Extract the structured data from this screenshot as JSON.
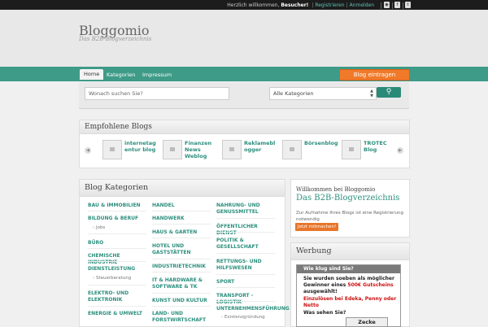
{
  "topbar": {
    "greeting_prefix": "Herzlich willkommen,",
    "greeting_user": "Besucher!",
    "register": "Registrieren",
    "login": "Anmelden",
    "separator": "|",
    "icons": [
      "rss-icon",
      "facebook-icon",
      "twitter-icon"
    ]
  },
  "site": {
    "title": "Bloggomio",
    "subtitle": "Das B2B-Blogverzeichnis"
  },
  "nav": {
    "items": [
      "Home",
      "Kategorien",
      "Impressum"
    ],
    "cta": "Blog eintragen"
  },
  "search": {
    "placeholder": "Wonach suchen Sie?",
    "category_selected": "Alle Kategorien",
    "button_icon": "search-icon"
  },
  "featured": {
    "title": "Empfohlene Blogs",
    "items": [
      {
        "name": "internetag entur blog"
      },
      {
        "name": "Finanzen News Weblog"
      },
      {
        "name": "Reklamebl ogger"
      },
      {
        "name": "Börsenblog"
      },
      {
        "name": "TROTEC Blog"
      }
    ]
  },
  "kategorien": {
    "title": "Blog Kategorien",
    "col1": [
      "BAU & IMMOBILIEN",
      "BILDUNG & BERUF",
      "Jobs",
      "BÜRO",
      "CHEMISCHE INDUSTRIE",
      "DIENSTLEISTUNG",
      "Steuerberatung",
      "ELEKTRO- UND ELEKTRONIK",
      "ENERGIE & UMWELT"
    ],
    "col2": [
      "HANDEL",
      "HANDWERK",
      "HAUS & GARTEN",
      "HOTEL UND GASTSTÄTTEN",
      "INDUSTRIETECHNIK",
      "IT & HARDWARE & SOFTWARE & TK",
      "KUNST UND KULTUR",
      "LAND- UND FORSTWIRTSCHAFT"
    ],
    "col3": [
      "NAHRUNG- UND GENUSSMITTEL",
      "ÖFFENTLICHER DIENST",
      "POLITIK & GESELLSCHAFT",
      "RETTUNGS- UND HILFSWESEN",
      "SPORT",
      "TRANSPORT - LOGISTIK",
      "UNTERNEHMENSFÜHRUNG",
      "Existenzgründung"
    ]
  },
  "welcome": {
    "title": "Willkommen bei Bloggomio",
    "subtitle": "Das B2B-Blogverzeichnis",
    "description": "Zur Aufnahme Ihres Blogs ist eine Registrierung notwendig",
    "button": "Jetzt mitmachen!"
  },
  "werbung": {
    "title": "Werbung",
    "ad_head": "Wie klug sind Sie?",
    "line1": "Sie wurden soeben als möglicher",
    "line2_pre": "Gewinner eines",
    "line2_red": "500€ Gutscheins",
    "line3": "ausgewählt!",
    "line4": "Einzulösen bei Edeka, Penny oder Netto",
    "line5": "Was sehen Sie?",
    "button": "Zecke"
  },
  "colors": {
    "accent": "#3e9b88",
    "link": "#2c8f7e",
    "cta": "#f07a2a",
    "topbar": "#1c1c1c"
  }
}
